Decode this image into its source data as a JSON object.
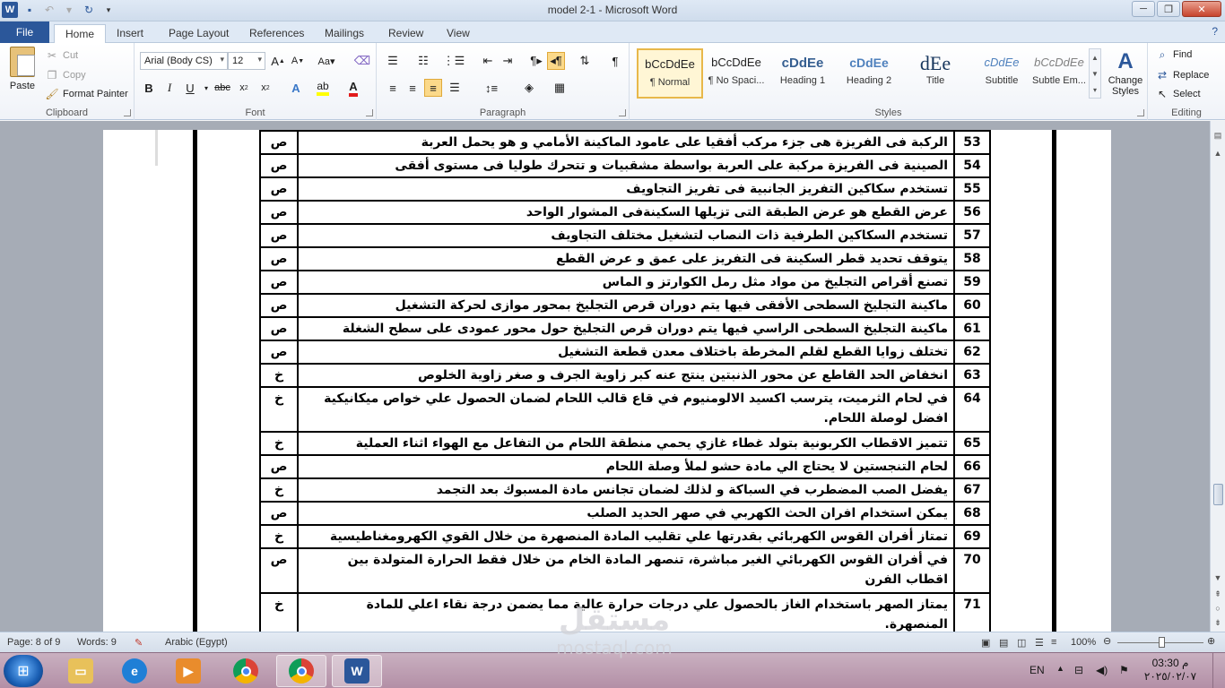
{
  "window": {
    "title": "model 2-1  -  Microsoft Word"
  },
  "tabs": [
    {
      "label": "File"
    },
    {
      "label": "Home"
    },
    {
      "label": "Insert"
    },
    {
      "label": "Page Layout"
    },
    {
      "label": "References"
    },
    {
      "label": "Mailings"
    },
    {
      "label": "Review"
    },
    {
      "label": "View"
    }
  ],
  "clipboard": {
    "paste": "Paste",
    "cut": "Cut",
    "copy": "Copy",
    "format_painter": "Format Painter",
    "group": "Clipboard"
  },
  "font": {
    "name": "Arial (Body CS)",
    "size": "12",
    "group": "Font"
  },
  "paragraph": {
    "group": "Paragraph"
  },
  "styles": {
    "items": [
      {
        "sample": "bCcDdEe",
        "name": "¶ Normal"
      },
      {
        "sample": "bCcDdEe",
        "name": "¶ No Spaci..."
      },
      {
        "sample": "cDdEe",
        "name": "Heading 1"
      },
      {
        "sample": "cDdEe",
        "name": "Heading 2"
      },
      {
        "sample": "dEe",
        "name": "Title"
      },
      {
        "sample": "cDdEe",
        "name": "Subtitle"
      },
      {
        "sample": "bCcDdEe",
        "name": "Subtle Em..."
      }
    ],
    "change_styles": "Change Styles",
    "group": "Styles"
  },
  "editing": {
    "find": "Find",
    "replace": "Replace",
    "select": "Select",
    "group": "Editing"
  },
  "document": {
    "rows": [
      {
        "num": "53",
        "text": "الركبة فى الفريزة هى جزء مركب أفقيا على عامود الماكينة الأمامي و هو يحمل العربة",
        "ans": "ص"
      },
      {
        "num": "54",
        "text": "الصينية فى الفريزة مركبة على العربة بواسطة مشقبيات و تتحرك طوليا فى مستوى أفقى",
        "ans": "ص"
      },
      {
        "num": "55",
        "text": "تستخدم سكاكين التفريز الجانبية فى تفريز التجاويف",
        "ans": "ص"
      },
      {
        "num": "56",
        "text": "عرض القطع هو عرض الطبقة التى تزيلها السكينةفى المشوار الواحد",
        "ans": "ص"
      },
      {
        "num": "57",
        "text": "تستخدم السكاكين الطرفية ذات النصاب لتشغيل مختلف التجاويف",
        "ans": "ص"
      },
      {
        "num": "58",
        "text": "يتوقف تحديد قطر السكينة فى التفريز على عمق و عرض القطع",
        "ans": "ص"
      },
      {
        "num": "59",
        "text": "تصنع أقراص التجليخ من مواد مثل رمل الكوارتز و الماس",
        "ans": "ص"
      },
      {
        "num": "60",
        "text": "ماكينة التجليخ السطحى الأفقى فيها يتم دوران قرص التجليخ بمحور موازى لحركة التشغيل",
        "ans": "ص"
      },
      {
        "num": "61",
        "text": "ماكينة التجليخ السطحى الراسي فيها يتم دوران قرص التجليخ حول محور عمودى على سطح الشغلة",
        "ans": "ص"
      },
      {
        "num": "62",
        "text": "تختلف زوايا القطع لقلم المخرطة باختلاف معدن قطعة التشغيل",
        "ans": "ص"
      },
      {
        "num": "63",
        "text": "انخفاض الحد القاطع عن محور الذنبتين ينتج عنه كبر زاوية الجرف و صغر زاوية الخلوص",
        "ans": "خ"
      },
      {
        "num": "64",
        "text": "في لحام الثرميت، يترسب اكسيد الالومنيوم في قاع قالب اللحام لضمان الحصول علي خواص ميكانيكية افضل لوصلة اللحام.",
        "ans": "خ"
      },
      {
        "num": "65",
        "text": "تتميز  الاقطاب الكربونية بتولد غطاء غازي يحمي منطقة اللحام من التفاعل مع الهواء اثناء العملية",
        "ans": "خ"
      },
      {
        "num": "66",
        "text": "لحام التنجستين لا يحتاج الي مادة حشو لملأ وصلة اللحام",
        "ans": "ص"
      },
      {
        "num": "67",
        "text": "يفضل الصب المضطرب في السباكة و  لذلك لضمان تجانس مادة المسبوك بعد التجمد",
        "ans": "خ"
      },
      {
        "num": "68",
        "text": "يمكن استخدام افران الحث الكهربي في صهر الحديد الصلب",
        "ans": "ص"
      },
      {
        "num": "69",
        "text": "تمتاز  أفران القوس الكهربائي بقدرتها علي تقليب المادة المنصهرة من خلال القوي الكهرومغناطيسية",
        "ans": "خ"
      },
      {
        "num": "70",
        "text": "في أفران القوس الكهربائي الغير مباشرة، تنصهر  المادة الخام من خلال فقط الحرارة المتولدة بين اقطاب الفرن",
        "ans": "ص"
      },
      {
        "num": "71",
        "text": "يمتاز  الصهر  باستخدام الغاز بالحصول علي درجات حرارة عالية مما يضمن درجة نقاء اعلي للمادة المنصهرة.",
        "ans": "خ"
      }
    ]
  },
  "status": {
    "page": "Page: 8 of 9",
    "words": "Words: 9",
    "language": "Arabic (Egypt)",
    "zoom": "100%"
  },
  "taskbar": {
    "lang": "EN",
    "ampm": "م 03:30",
    "date": "٢٠٢٥/٠٢/٠٧"
  },
  "watermark": {
    "arabic": "مستقل",
    "latin": "mostaql.com"
  },
  "colors": {
    "file_tab": "#2b579a",
    "selected_style": "#fff6d5",
    "page_bg": "#ffffff",
    "doc_bg": "#a6acb6"
  }
}
